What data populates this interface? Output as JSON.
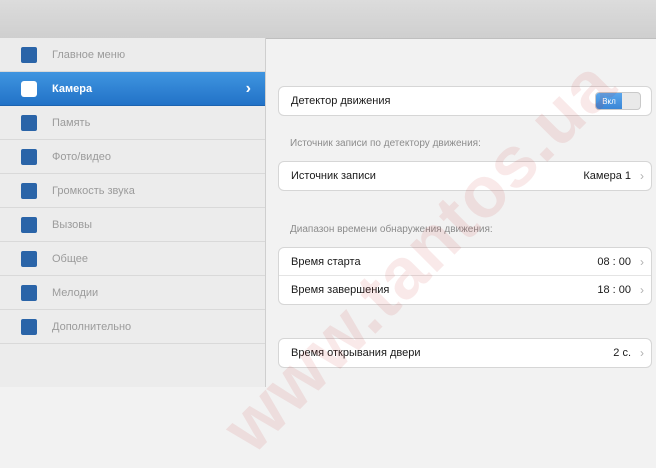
{
  "sidebar": {
    "items": [
      {
        "label": "Главное меню",
        "icon": "home-icon",
        "active": false
      },
      {
        "label": "Камера",
        "icon": "camera-icon",
        "active": true
      },
      {
        "label": "Память",
        "icon": "save-icon",
        "active": false
      },
      {
        "label": "Фото/видео",
        "icon": "film-icon",
        "active": false
      },
      {
        "label": "Громкость звука",
        "icon": "microphone-icon",
        "active": false
      },
      {
        "label": "Вызовы",
        "icon": "phone-icon",
        "active": false
      },
      {
        "label": "Общее",
        "icon": "settings-icon",
        "active": false
      },
      {
        "label": "Мелодии",
        "icon": "music-icon",
        "active": false
      },
      {
        "label": "Дополнительно",
        "icon": "monitor-icon",
        "active": false
      }
    ]
  },
  "content": {
    "motion_detector": {
      "label": "Детектор движения",
      "toggle_label": "Вкл",
      "enabled": true
    },
    "source_section_label": "Источник записи по детектору движения:",
    "source": {
      "label": "Источник записи",
      "value": "Камера 1"
    },
    "time_section_label": "Диапазон времени обнаружения движения:",
    "start_time": {
      "label": "Время старта",
      "value": "08 : 00"
    },
    "end_time": {
      "label": "Время завершения",
      "value": "18 : 00"
    },
    "door_time": {
      "label": "Время открывания двери",
      "value": "2 с."
    }
  },
  "watermark": {
    "text": "www.tantos.ua"
  },
  "colors": {
    "accent": "#2a7ad2",
    "sidebar_bg": "#ececec",
    "content_bg": "#f2f2f2"
  }
}
